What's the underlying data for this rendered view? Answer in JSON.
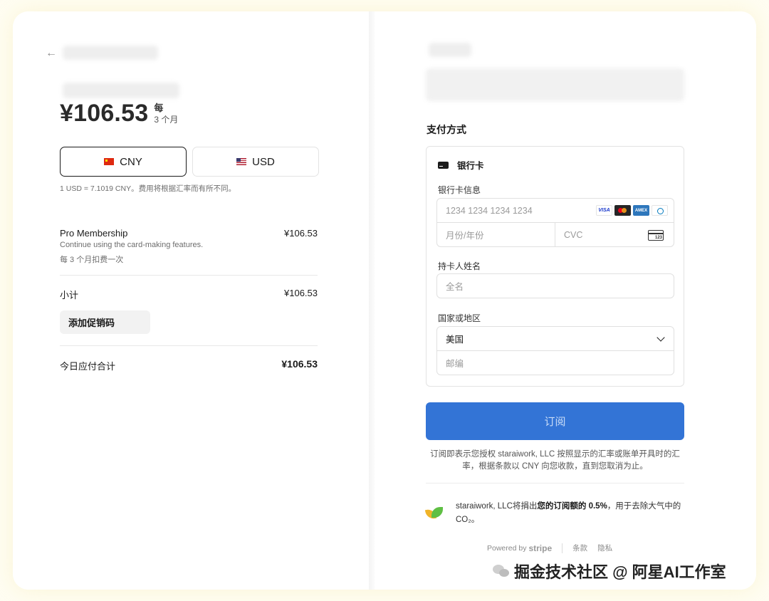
{
  "summary": {
    "price": "¥106.53",
    "per_top": "每",
    "per_bottom": "3 个月",
    "currency_options": [
      {
        "code": "CNY",
        "flag": "cn-flag-icon",
        "selected": true
      },
      {
        "code": "USD",
        "flag": "us-flag-icon",
        "selected": false
      }
    ],
    "rate_note": "1 USD = 7.1019 CNY。费用将根据汇率而有所不同。",
    "item": {
      "name": "Pro Membership",
      "description": "Continue using the card-making features.",
      "frequency": "每 3 个月扣费一次",
      "price": "¥106.53"
    },
    "subtotal_label": "小计",
    "subtotal_value": "¥106.53",
    "promo_label": "添加促销码",
    "total_label": "今日应付合计",
    "total_value": "¥106.53"
  },
  "payment": {
    "section_title": "支付方式",
    "method_label": "银行卡",
    "card_info_label": "银行卡信息",
    "card_number_placeholder": "1234 1234 1234 1234",
    "card_brands": [
      "VISA",
      "mastercard",
      "AMEX",
      "diners"
    ],
    "expiry_placeholder": "月份/年份",
    "cvc_placeholder": "CVC",
    "cvc_icon_text": "123",
    "name_label": "持卡人姓名",
    "name_placeholder": "全名",
    "country_label": "国家或地区",
    "country_value": "美国",
    "postal_placeholder": "邮编",
    "subscribe_label": "订阅",
    "legal_text": "订阅即表示您授权 staraiwork, LLC 按照显示的汇率或账单开具时的汇率，根据条款以 CNY 向您收款，直到您取消为止。",
    "climate_prefix": "staraiwork, LLC将捐出",
    "climate_bold": "您的订阅额的 0.5%",
    "climate_suffix": "，用于去除大气中的 CO₂。",
    "powered_by": "Powered by",
    "stripe_brand": "stripe",
    "terms_link": "条款",
    "privacy_link": "隐私"
  },
  "watermark": {
    "text": "掘金技术社区 @ 阿星AI工作室"
  },
  "colors": {
    "accent": "#3374d6",
    "page_background": "#fffdf2"
  }
}
